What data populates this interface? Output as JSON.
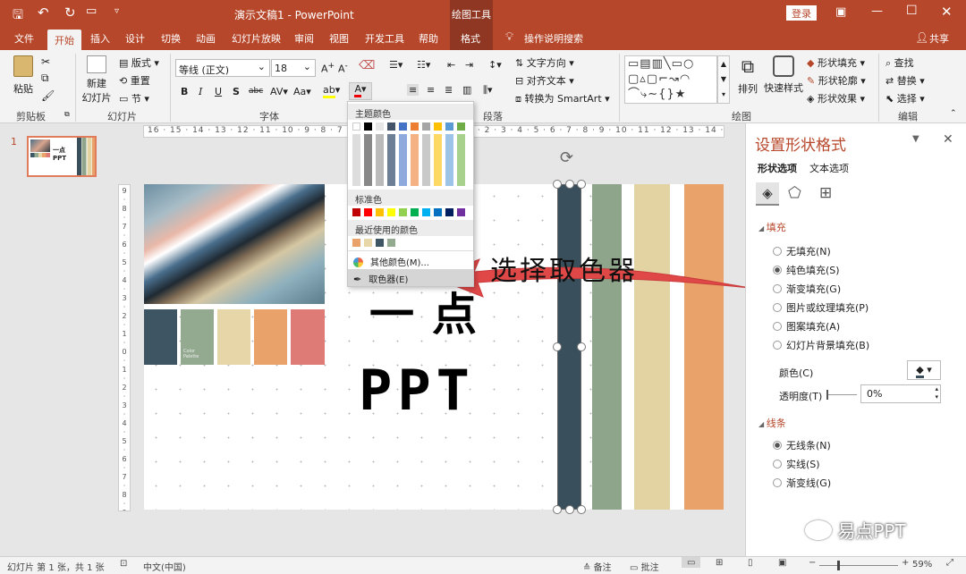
{
  "titlebar": {
    "doc_title": "演示文稿1  -  PowerPoint",
    "context_tab": "绘图工具",
    "login": "登录"
  },
  "tabs": [
    "文件",
    "开始",
    "插入",
    "设计",
    "切换",
    "动画",
    "幻灯片放映",
    "审阅",
    "视图",
    "开发工具",
    "帮助",
    "格式"
  ],
  "tell_me": "操作说明搜索",
  "share": "共享",
  "ribbon": {
    "clipboard": {
      "label": "剪贴板",
      "paste": "粘贴"
    },
    "slides": {
      "label": "幻灯片",
      "new_line1": "新建",
      "new_line2": "幻灯片",
      "layout": "版式",
      "reset": "重置",
      "section": "节"
    },
    "font": {
      "label": "字体",
      "font_name": "等线 (正文)",
      "font_size": "18"
    },
    "paragraph": {
      "label": "段落",
      "text_direction": "文字方向",
      "align_text": "对齐文本",
      "smartart": "转换为 SmartArt"
    },
    "drawing": {
      "label": "绘图",
      "arrange": "排列",
      "quick_styles": "快速样式",
      "fill": "形状填充",
      "outline": "形状轮廓",
      "effects": "形状效果"
    },
    "editing": {
      "label": "编辑",
      "find": "查找",
      "replace": "替换",
      "select": "选择"
    }
  },
  "color_menu": {
    "theme": "主题颜色",
    "standard": "标准色",
    "recent": "最近使用的颜色",
    "more": "其他颜色(M)...",
    "eyedropper": "取色器(E)",
    "theme_top": [
      "#ffffff",
      "#000000",
      "#e7e6e6",
      "#44546a",
      "#4472c4",
      "#ed7d31",
      "#a5a5a5",
      "#ffc000",
      "#5b9bd5",
      "#70ad47"
    ],
    "standard_colors": [
      "#c00000",
      "#ff0000",
      "#ffc000",
      "#ffff00",
      "#92d050",
      "#00b050",
      "#00b0f0",
      "#0070c0",
      "#002060",
      "#7030a0"
    ],
    "recent_colors": [
      "#e8a26a",
      "#e6d6a8",
      "#3e5663",
      "#93aa90"
    ]
  },
  "annotation": "选择取色器",
  "slide": {
    "text_line1": "一点",
    "text_line2": "PPT",
    "palette_caption": "Color Palette",
    "swatches": [
      "#3e5663",
      "#93aa90",
      "#e6d6a8",
      "#e8a26a",
      "#de7b76"
    ],
    "stripes": [
      "#3a4f5c",
      "#8fa58b",
      "#e3d3a3",
      "#e8a26a"
    ]
  },
  "thumb": {
    "number": "1"
  },
  "format_panel": {
    "title": "设置形状格式",
    "tab1": "形状选项",
    "tab2": "文本选项",
    "fill_section": "填充",
    "fill_options": [
      "无填充(N)",
      "纯色填充(S)",
      "渐变填充(G)",
      "图片或纹理填充(P)",
      "图案填充(A)",
      "幻灯片背景填充(B)"
    ],
    "selected_fill": 1,
    "color_label": "颜色(C)",
    "transparency_label": "透明度(T)",
    "transparency_value": "0%",
    "line_section": "线条",
    "line_options": [
      "无线条(N)",
      "实线(S)",
      "渐变线(G)"
    ],
    "selected_line": 0
  },
  "status": {
    "slide_info": "幻灯片 第 1 张，共 1 张",
    "language": "中文(中国)",
    "notes": "备注",
    "comments": "批注",
    "zoom": "59%"
  },
  "watermark": "易点PPT"
}
